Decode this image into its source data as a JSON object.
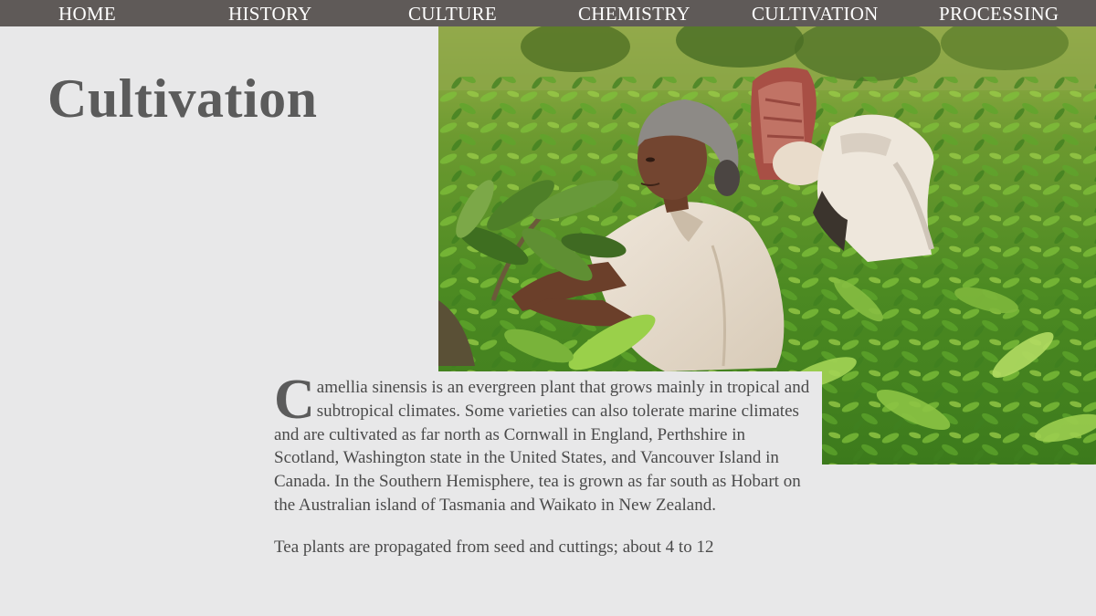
{
  "nav": {
    "items": [
      {
        "label": "HOME"
      },
      {
        "label": "HISTORY"
      },
      {
        "label": "CULTURE"
      },
      {
        "label": "CHEMISTRY"
      },
      {
        "label": "CULTIVATION"
      },
      {
        "label": "PROCESSING"
      }
    ],
    "background_color": "#5f5a58",
    "text_color": "#ffffff"
  },
  "page": {
    "title": "Cultivation",
    "background_color": "#e8e8e9",
    "title_color": "#5b5b5b",
    "text_color": "#4a4a4a"
  },
  "hero_image": {
    "subject": "tea pickers harvesting leaves in a tea plantation",
    "icon": "photo-image"
  },
  "article": {
    "paragraphs": [
      {
        "drop_cap": "C",
        "text": "amellia sinensis is an evergreen plant that grows mainly in tropical and subtropical climates. Some varieties can also tolerate marine climates and are cultivated as far north as Cornwall in England, Perthshire in Scotland, Washington state in the United States, and Vancouver Island in Canada. In the Southern Hemisphere, tea is grown as far south as Hobart on the Australian island of Tasmania and Waikato in New Zealand."
      },
      {
        "text": "Tea plants are propagated from seed and cuttings; about 4 to 12"
      }
    ]
  }
}
